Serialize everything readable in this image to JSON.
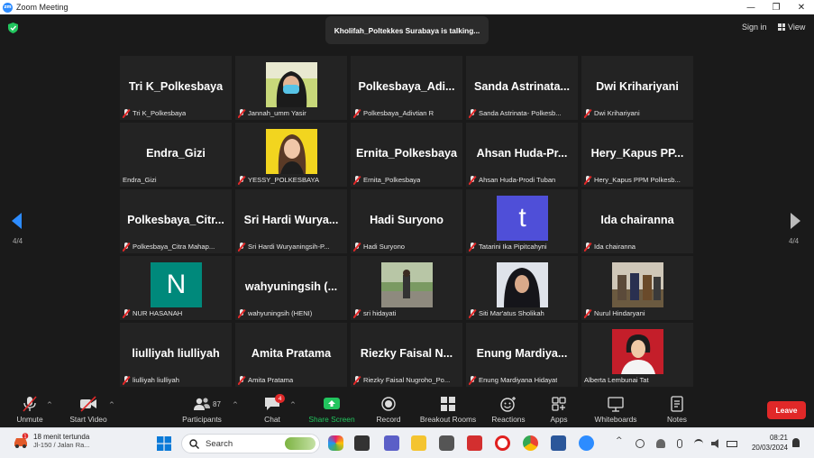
{
  "window": {
    "title": "Zoom Meeting"
  },
  "header": {
    "talking": "Kholifah_Poltekkes Surabaya is talking...",
    "sign_in": "Sign in",
    "view": "View"
  },
  "paging": {
    "left": "4/4",
    "right": "4/4"
  },
  "tiles": [
    {
      "big": "Tri K_Polkesbaya",
      "label": "Tri K_Polkesbaya",
      "muted": true
    },
    {
      "big": "",
      "label": "Jannah_umm Yasir",
      "muted": true,
      "photo": "hijab-mask"
    },
    {
      "big": "Polkesbaya_Adi...",
      "label": "Polkesbaya_Adivtian R",
      "muted": true
    },
    {
      "big": "Sanda  Astrinata...",
      "label": "Sanda Astrinata- Polkesb...",
      "muted": true
    },
    {
      "big": "Dwi Krihariyani",
      "label": "Dwi Krihariyani",
      "muted": true
    },
    {
      "big": "Endra_Gizi",
      "label": "Endra_Gizi",
      "muted": false
    },
    {
      "big": "",
      "label": "YESSY_POLKESBAYA",
      "muted": true,
      "photo": "woman-yellow"
    },
    {
      "big": "Ernita_Polkesbaya",
      "label": "Ernita_Polkesbaya",
      "muted": true
    },
    {
      "big": "Ahsan  Huda-Pr...",
      "label": "Ahsan Huda-Prodi Tuban",
      "muted": true
    },
    {
      "big": "Hery_Kapus  PP...",
      "label": "Hery_Kapus PPM Polkesb...",
      "muted": true
    },
    {
      "big": "Polkesbaya_Citr...",
      "label": "Polkesbaya_Citra Mahap...",
      "muted": true
    },
    {
      "big": "Sri Hardi Wurya...",
      "label": "Sri Hardi Wuryaningsih-P...",
      "muted": true
    },
    {
      "big": "Hadi Suryono",
      "label": "Hadi Suryono",
      "muted": true
    },
    {
      "big": "",
      "label": "Tatarini Ika Pipitcahyni",
      "muted": true,
      "letter": "t",
      "letter_color": "#4f4fd8"
    },
    {
      "big": "Ida chairanna",
      "label": "Ida chairanna",
      "muted": true
    },
    {
      "big": "",
      "label": "NUR HASANAH",
      "muted": true,
      "letter": "N",
      "letter_color": "#00897b"
    },
    {
      "big": "wahyuningsih  (...",
      "label": "wahyuningsih (HENI)",
      "muted": true
    },
    {
      "big": "",
      "label": "sri hidayati",
      "muted": true,
      "photo": "garden"
    },
    {
      "big": "",
      "label": "Siti Mar'atus Sholikah",
      "muted": true,
      "photo": "hijab-black"
    },
    {
      "big": "",
      "label": "Nurul Hindaryani",
      "muted": true,
      "photo": "group"
    },
    {
      "big": "liulliyah liulliyah",
      "label": "liulliyah liulliyah",
      "muted": true
    },
    {
      "big": "Amita Pratama",
      "label": "Amita Pratama",
      "muted": true
    },
    {
      "big": "Riezky Faisal N...",
      "label": "Riezky Faisal Nugroho_Po...",
      "muted": true
    },
    {
      "big": "Enung  Mardiya...",
      "label": "Enung Mardiyana Hidayat",
      "muted": true
    },
    {
      "big": "",
      "label": "Alberta Lembunai Tat",
      "muted": false,
      "photo": "portrait-red"
    }
  ],
  "toolbar": {
    "unmute": "Unmute",
    "start_video": "Start Video",
    "participants": "Participants",
    "participants_count": "87",
    "chat": "Chat",
    "chat_badge": "4",
    "share": "Share Screen",
    "record": "Record",
    "breakout": "Breakout Rooms",
    "reactions": "Reactions",
    "apps": "Apps",
    "whiteboards": "Whiteboards",
    "notes": "Notes",
    "leave": "Leave"
  },
  "taskbar": {
    "weather_line1": "18 menit tertunda",
    "weather_line2": "Jl-150 / Jalan Ra...",
    "weather_badge": "1",
    "search": "Search",
    "time": "08:21",
    "date": "20/03/2024"
  },
  "colors": {
    "accent": "#2d8cff",
    "share_green": "#22c55e",
    "leave_red": "#e02828"
  }
}
